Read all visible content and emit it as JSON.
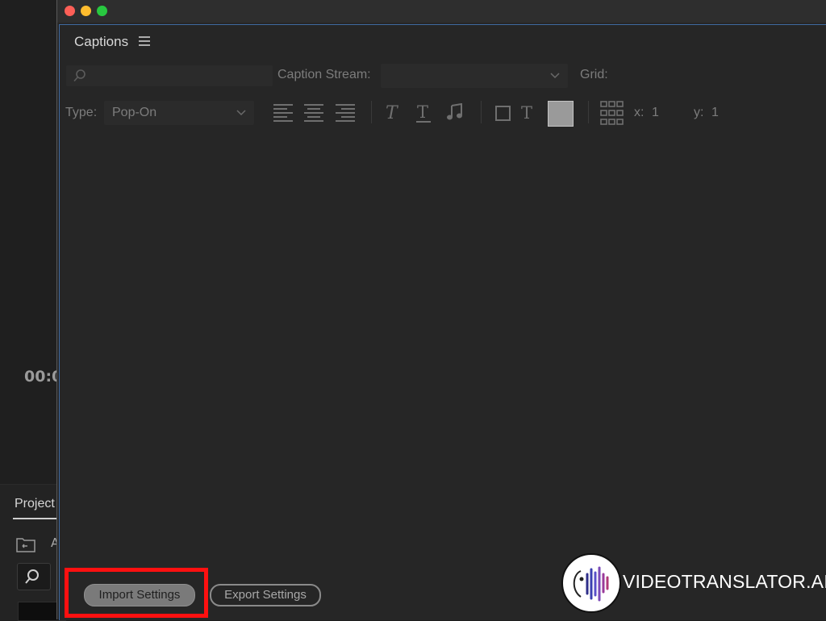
{
  "window": {
    "panel_title": "Captions"
  },
  "toolbar": {
    "search_placeholder": "",
    "caption_stream_label": "Caption Stream:",
    "caption_stream_value": "",
    "grid_label": "Grid:",
    "type_label": "Type:",
    "type_value": "Pop-On",
    "x_label": "x:",
    "x_value": "1",
    "y_label": "y:",
    "y_value": "1"
  },
  "footer": {
    "import_label": "Import Settings",
    "export_label": "Export Settings"
  },
  "background_app": {
    "timecode": "00:0",
    "project_tab": "Project",
    "letter": "A"
  },
  "watermark": {
    "text": "VIDEOTRANSLATOR.AI"
  },
  "colors": {
    "traffic_red": "#fe5f57",
    "traffic_yellow": "#febc2e",
    "traffic_green": "#28c840",
    "highlight": "#ff1010",
    "panel_border": "#3f6aa0"
  },
  "icons": {
    "align": [
      "align-left-icon",
      "align-center-icon",
      "align-right-icon"
    ],
    "text_style": [
      "italic-icon",
      "underline-icon",
      "music-note-icon"
    ],
    "background": [
      "background-checkbox-icon",
      "text-color-icon"
    ],
    "grid": "grid-position-icon"
  }
}
